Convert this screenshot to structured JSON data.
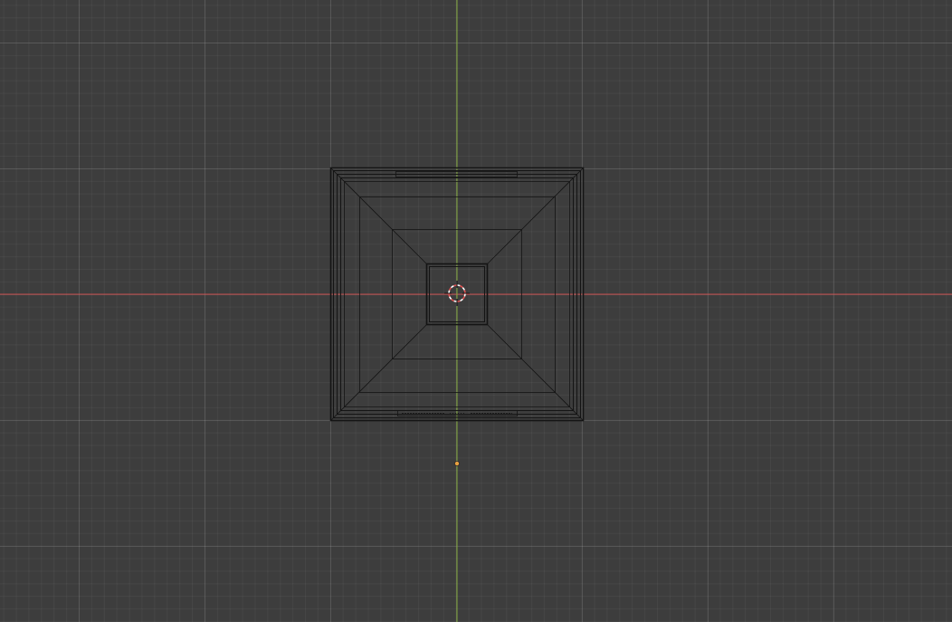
{
  "viewport": {
    "view": "top",
    "shading": "wireframe"
  },
  "colors": {
    "background": "#3d3d3d",
    "x_axis": "#c84a4a",
    "y_axis": "#7fa83a",
    "wire": "#141414",
    "cursor_red": "#e05050",
    "cursor_white": "#ffffff",
    "origin": "#e8a040"
  },
  "icons": {
    "cursor": "3d-cursor-icon",
    "origin": "object-origin-icon"
  }
}
